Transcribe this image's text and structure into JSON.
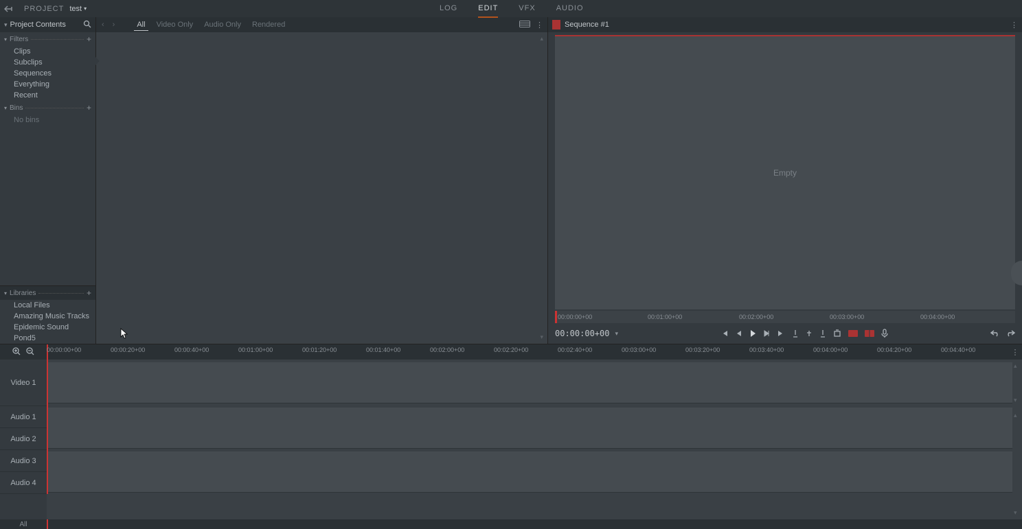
{
  "header": {
    "project_label": "PROJECT",
    "project_name": "test",
    "tabs": [
      "LOG",
      "EDIT",
      "VFX",
      "AUDIO"
    ],
    "active_tab": "EDIT"
  },
  "sidebar": {
    "contents_title": "Project Contents",
    "filters_label": "Filters",
    "filter_items": [
      "Clips",
      "Subclips",
      "Sequences",
      "Everything",
      "Recent"
    ],
    "bins_label": "Bins",
    "bins_empty": "No bins",
    "libraries_label": "Libraries",
    "library_items": [
      "Local Files",
      "Amazing Music Tracks",
      "Epidemic Sound",
      "Pond5"
    ]
  },
  "browser": {
    "filters": [
      "All",
      "Video Only",
      "Audio Only",
      "Rendered"
    ],
    "active_filter": "All"
  },
  "viewer": {
    "title": "Sequence #1",
    "empty_text": "Empty",
    "timecode": "00:00:00+00",
    "ruler_ticks": [
      {
        "pos": 4,
        "label": "00:00:00+00"
      },
      {
        "pos": 135,
        "label": "00:01:00+00"
      },
      {
        "pos": 268,
        "label": "00:02:00+00"
      },
      {
        "pos": 400,
        "label": "00:03:00+00"
      },
      {
        "pos": 532,
        "label": "00:04:00+00"
      }
    ]
  },
  "timeline": {
    "ruler_ticks": [
      {
        "pos": 0,
        "label": "00:00:00+00"
      },
      {
        "pos": 93,
        "label": "00:00:20+00"
      },
      {
        "pos": 186,
        "label": "00:00:40+00"
      },
      {
        "pos": 279,
        "label": "00:01:00+00"
      },
      {
        "pos": 372,
        "label": "00:01:20+00"
      },
      {
        "pos": 465,
        "label": "00:01:40+00"
      },
      {
        "pos": 558,
        "label": "00:02:00+00"
      },
      {
        "pos": 651,
        "label": "00:02:20+00"
      },
      {
        "pos": 744,
        "label": "00:02:40+00"
      },
      {
        "pos": 837,
        "label": "00:03:00+00"
      },
      {
        "pos": 930,
        "label": "00:03:20+00"
      },
      {
        "pos": 1023,
        "label": "00:03:40+00"
      },
      {
        "pos": 1116,
        "label": "00:04:00+00"
      },
      {
        "pos": 1209,
        "label": "00:04:20+00"
      },
      {
        "pos": 1302,
        "label": "00:04:40+00"
      }
    ],
    "tracks": {
      "video1": "Video 1",
      "audio1": "Audio 1",
      "audio2": "Audio 2",
      "audio3": "Audio 3",
      "audio4": "Audio 4"
    },
    "mini_label": "All"
  }
}
